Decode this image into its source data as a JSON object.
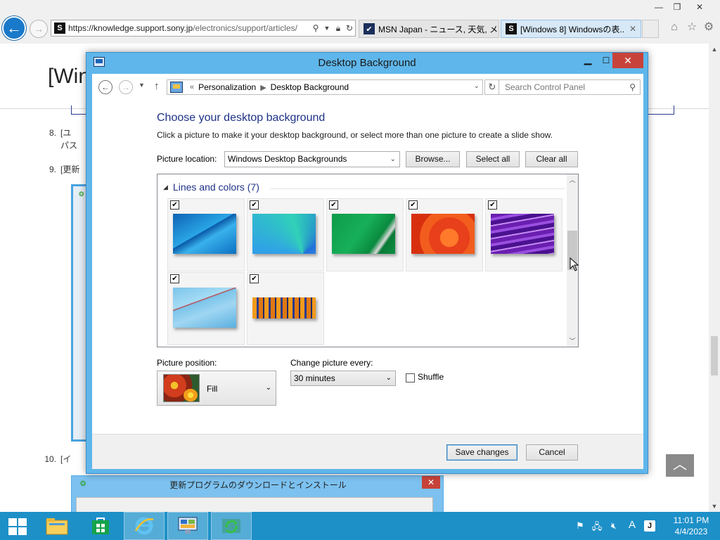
{
  "browser": {
    "url_host": "https://knowledge.support.sony.jp",
    "url_path": "/electronics/support/articles/",
    "tabs": [
      {
        "label": "MSN Japan - ニュース, 天気, メ...",
        "favicon": "msn-icon"
      },
      {
        "label": "[Windows 8] Windowsの表...",
        "favicon": "sony-s-icon"
      }
    ]
  },
  "web_page": {
    "heading": "[Win",
    "steps": [
      {
        "num": "8.",
        "text": "[ユ",
        "text2": "パス"
      },
      {
        "num": "9.",
        "text": "[更新"
      },
      {
        "num": "10.",
        "text": "[イ"
      }
    ],
    "update_window_title": "更新プログラムのダウンロードとインストール"
  },
  "dialog": {
    "title": "Desktop Background",
    "breadcrumb": [
      "Personalization",
      "Desktop Background"
    ],
    "search_placeholder": "Search Control Panel",
    "heading": "Choose your desktop background",
    "instruction": "Click a picture to make it your desktop background, or select more than one picture to create a slide show.",
    "picture_location_label": "Picture location:",
    "picture_location_value": "Windows Desktop Backgrounds",
    "browse_label": "Browse...",
    "select_all_label": "Select all",
    "clear_all_label": "Clear all",
    "group_label": "Lines and colors (7)",
    "wallpapers": [
      {
        "name": "blue-lines",
        "checked": true
      },
      {
        "name": "blue-fan",
        "checked": true
      },
      {
        "name": "green-stripes",
        "checked": true
      },
      {
        "name": "orange-swirl",
        "checked": true
      },
      {
        "name": "purple-waves",
        "checked": true
      },
      {
        "name": "light-blue-curves",
        "checked": true
      },
      {
        "name": "orange-buildings",
        "checked": true
      }
    ],
    "picture_position_label": "Picture position:",
    "picture_position_value": "Fill",
    "change_every_label": "Change picture every:",
    "change_every_value": "30 minutes",
    "shuffle_label": "Shuffle",
    "shuffle_checked": false,
    "save_label": "Save changes",
    "cancel_label": "Cancel"
  },
  "taskbar": {
    "clock_time": "11:01 PM",
    "clock_date": "4/4/2023"
  }
}
